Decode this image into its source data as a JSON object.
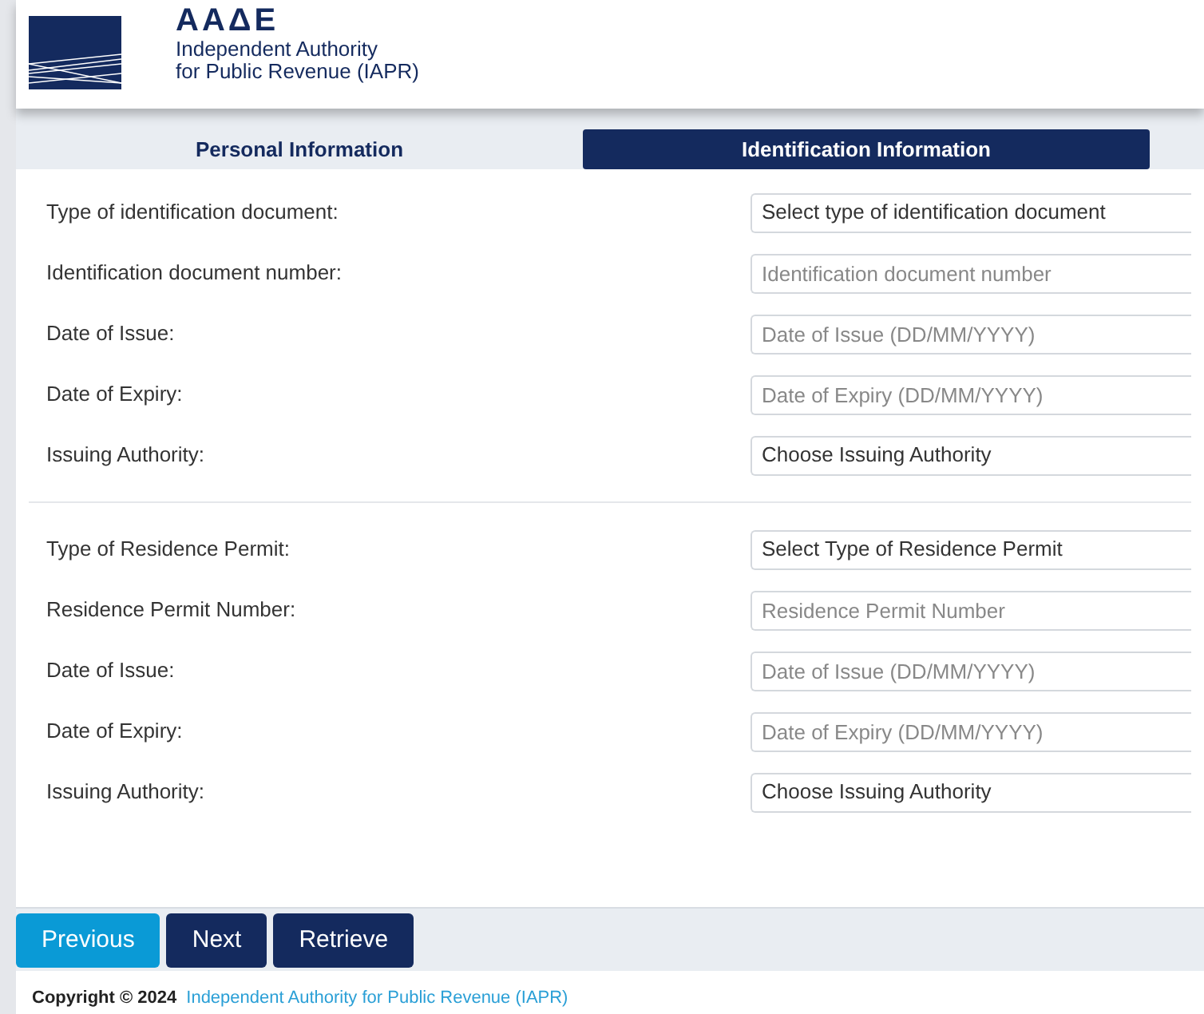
{
  "header": {
    "logo_text": "ΑΑΔΕ",
    "org_line_1": "Independent Authority",
    "org_line_2": "for Public Revenue (IAPR)"
  },
  "tabs": [
    {
      "label": "Personal Information",
      "selected": false
    },
    {
      "label": "Identification Information",
      "selected": true
    }
  ],
  "sections": [
    {
      "fields": [
        {
          "label": "Type of identification document:",
          "kind": "select",
          "value": "Select type of identification document"
        },
        {
          "label": "Identification document number:",
          "kind": "input",
          "placeholder": "Identification document number"
        },
        {
          "label": "Date of Issue:",
          "kind": "input",
          "placeholder": "Date of Issue (DD/MM/YYYY)"
        },
        {
          "label": "Date of Expiry:",
          "kind": "input",
          "placeholder": "Date of Expiry (DD/MM/YYYY)"
        },
        {
          "label": "Issuing Authority:",
          "kind": "select",
          "value": "Choose Issuing Authority"
        }
      ]
    },
    {
      "fields": [
        {
          "label": "Type of Residence Permit:",
          "kind": "select",
          "value": "Select Type of Residence Permit"
        },
        {
          "label": "Residence Permit Number:",
          "kind": "input",
          "placeholder": "Residence Permit Number"
        },
        {
          "label": "Date of Issue:",
          "kind": "input",
          "placeholder": "Date of Issue (DD/MM/YYYY)"
        },
        {
          "label": "Date of Expiry:",
          "kind": "input",
          "placeholder": "Date of Expiry (DD/MM/YYYY)"
        },
        {
          "label": "Issuing Authority:",
          "kind": "select",
          "value": "Choose Issuing Authority"
        }
      ]
    }
  ],
  "buttons": [
    {
      "label": "Previous",
      "kind": "light"
    },
    {
      "label": "Next",
      "kind": "dark"
    },
    {
      "label": "Retrieve",
      "kind": "dark"
    }
  ],
  "footer": {
    "copyright": "Copyright © 2024",
    "link": "Independent Authority for Public Revenue (IAPR)"
  }
}
